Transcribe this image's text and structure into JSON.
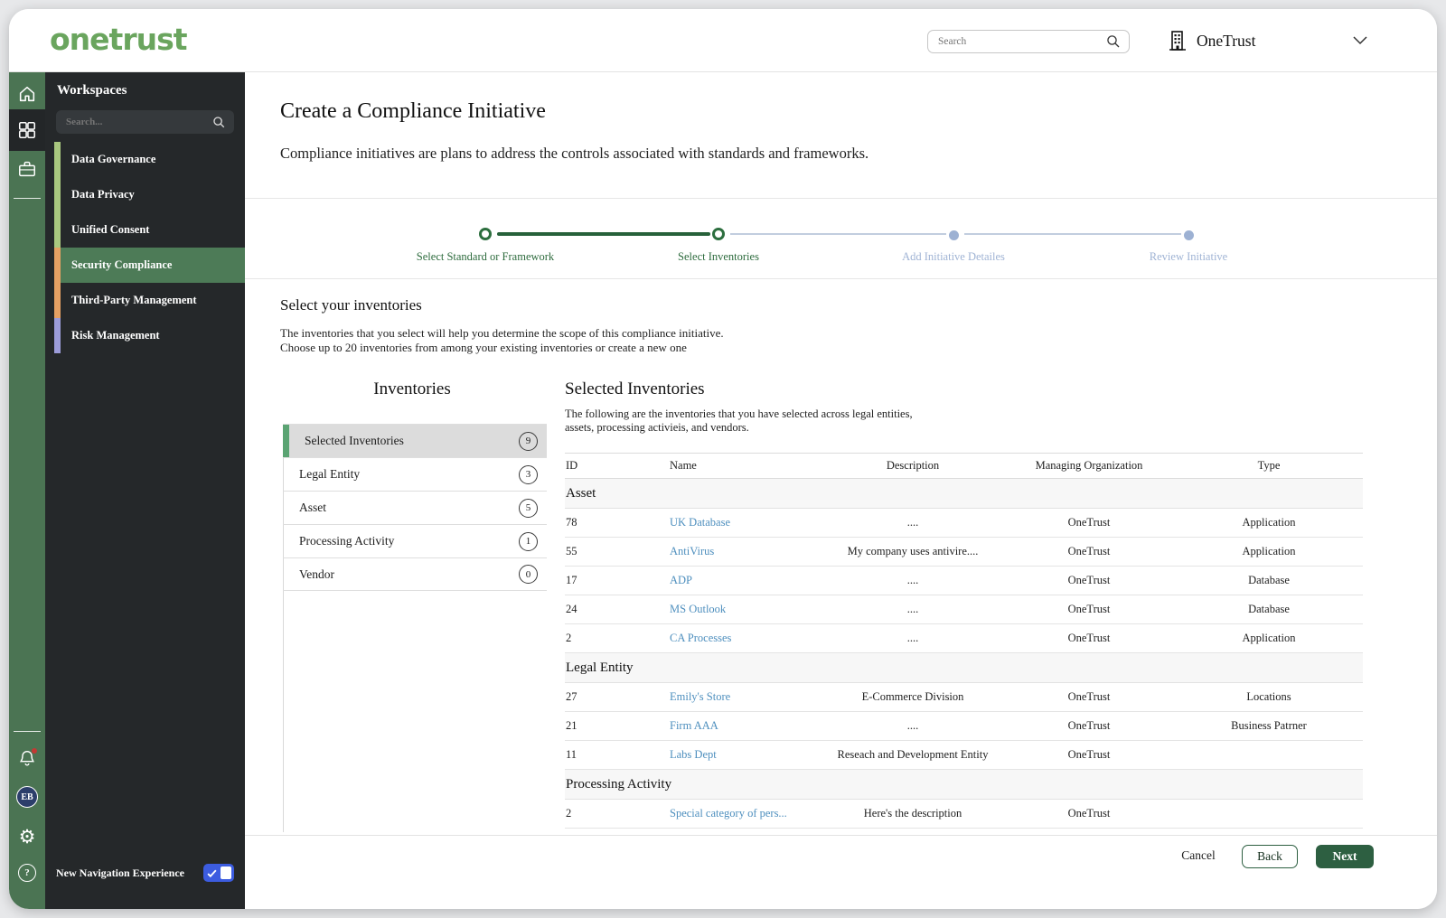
{
  "app": {
    "logo_text": "onetrust",
    "logo_color": "#6aa55e"
  },
  "header": {
    "search_placeholder": "Search",
    "org_name": "OneTrust"
  },
  "sidebar": {
    "title": "Workspaces",
    "search_placeholder": "Search...",
    "items": [
      {
        "label": "Data Governance",
        "accent": "#a9c77f",
        "active": false
      },
      {
        "label": "Data Privacy",
        "accent": "#a9c77f",
        "active": false
      },
      {
        "label": "Unified Consent",
        "accent": "#a9c77f",
        "active": false
      },
      {
        "label": "Security Compliance",
        "accent": "#e5a063",
        "active": true
      },
      {
        "label": "Third-Party Management",
        "accent": "#e5a063",
        "active": false
      },
      {
        "label": "Risk Management",
        "accent": "#9c9cd9",
        "active": false
      }
    ],
    "avatar_initials": "EB",
    "footer_toggle_label": "New Navigation Experience",
    "toggle_color": "#3c5ce0"
  },
  "page": {
    "title": "Create a Compliance Initiative",
    "subtitle": "Compliance initiatives are plans to address the controls associated with standards and frameworks."
  },
  "stepper": {
    "active_color": "#2c6e3e",
    "inactive_color": "#9db1d3",
    "steps": [
      {
        "label": "Select Standard or Framework",
        "state": "complete"
      },
      {
        "label": "Select Inventories",
        "state": "current"
      },
      {
        "label": "Add Initiative Detailes",
        "state": "upcoming"
      },
      {
        "label": "Review Initiative",
        "state": "upcoming"
      }
    ]
  },
  "section": {
    "title": "Select your inventories",
    "description_line1": "The inventories that you select will help you determine the scope of this compliance initiative.",
    "description_line2": "Choose up to 20 inventories from among your existing inventories or create a new one"
  },
  "inventories_panel": {
    "title": "Inventories",
    "items": [
      {
        "label": "Selected Inventories",
        "count": "9",
        "selected": true
      },
      {
        "label": "Legal Entity",
        "count": "3",
        "selected": false
      },
      {
        "label": "Asset",
        "count": "5",
        "selected": false
      },
      {
        "label": "Processing Activity",
        "count": "1",
        "selected": false
      },
      {
        "label": "Vendor",
        "count": "0",
        "selected": false
      }
    ]
  },
  "selected_inventories": {
    "title": "Selected Inventories",
    "description_line1": "The following are the inventories that you have selected across legal entities,",
    "description_line2": "assets, processing activieis, and vendors.",
    "columns": [
      "ID",
      "Name",
      "Description",
      "Managing Organization",
      "Type"
    ],
    "link_color": "#4e8fbe",
    "groups": [
      {
        "name": "Asset",
        "rows": [
          {
            "id": "78",
            "name": "UK Database",
            "description": "....",
            "org": "OneTrust",
            "type": "Application"
          },
          {
            "id": "55",
            "name": "AntiVirus",
            "description": "My company uses antivire....",
            "org": "OneTrust",
            "type": "Application"
          },
          {
            "id": "17",
            "name": "ADP",
            "description": "....",
            "org": "OneTrust",
            "type": "Database"
          },
          {
            "id": "24",
            "name": "MS Outlook",
            "description": "....",
            "org": "OneTrust",
            "type": "Database"
          },
          {
            "id": "2",
            "name": "CA Processes",
            "description": "....",
            "org": "OneTrust",
            "type": "Application"
          }
        ]
      },
      {
        "name": "Legal Entity",
        "rows": [
          {
            "id": "27",
            "name": "Emily's Store",
            "description": "E-Commerce Division",
            "org": "OneTrust",
            "type": "Locations"
          },
          {
            "id": "21",
            "name": "Firm AAA",
            "description": "....",
            "org": "OneTrust",
            "type": "Business Patrner"
          },
          {
            "id": "11",
            "name": "Labs Dept",
            "description": "Reseach and Development Entity",
            "org": "OneTrust",
            "type": ""
          }
        ]
      },
      {
        "name": "Processing Activity",
        "rows": [
          {
            "id": "2",
            "name": "Special category of pers...",
            "description": "Here's the description",
            "org": "OneTrust",
            "type": ""
          }
        ]
      }
    ]
  },
  "footer": {
    "cancel_label": "Cancel",
    "back_label": "Back",
    "next_label": "Next"
  },
  "icons": {
    "header": [
      "search-icon",
      "building-icon",
      "chevron-down-icon"
    ],
    "rail": [
      "home-icon",
      "grid-icon",
      "briefcase-icon",
      "bell-icon",
      "gear-icon",
      "help-icon"
    ]
  }
}
